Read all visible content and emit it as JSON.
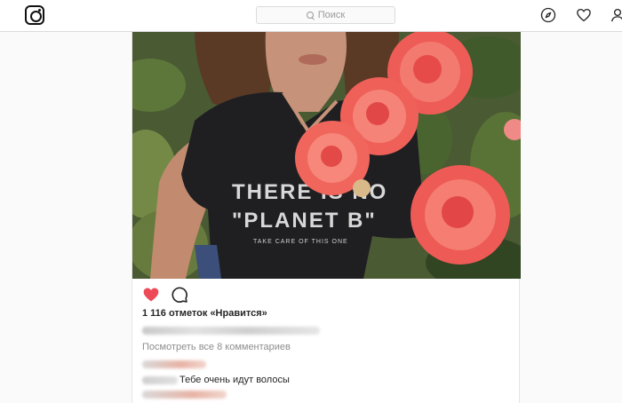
{
  "header": {
    "logo": "instagram-glyph",
    "search": {
      "placeholder": "Поиск",
      "icon": "search-icon"
    },
    "nav_icons": [
      "compass-icon",
      "heart-icon",
      "user-icon"
    ]
  },
  "photo": {
    "shirt_text_line1": "THERE IS NO",
    "shirt_text_line2": "\"PLANET B\"",
    "shirt_text_line3": "TAKE CARE OF THIS ONE"
  },
  "post": {
    "action_icons": [
      "heart-filled-icon",
      "comment-icon"
    ],
    "likes": "1 116 отметок «Нравится»",
    "view_all_comments": "Посмотреть все 8 комментариев",
    "comment_text": "Тебе очень идут волосы"
  },
  "colors": {
    "heart": "#ed4956",
    "text": "#262626",
    "muted": "#8e8e8e",
    "border": "#dbdbdb"
  }
}
